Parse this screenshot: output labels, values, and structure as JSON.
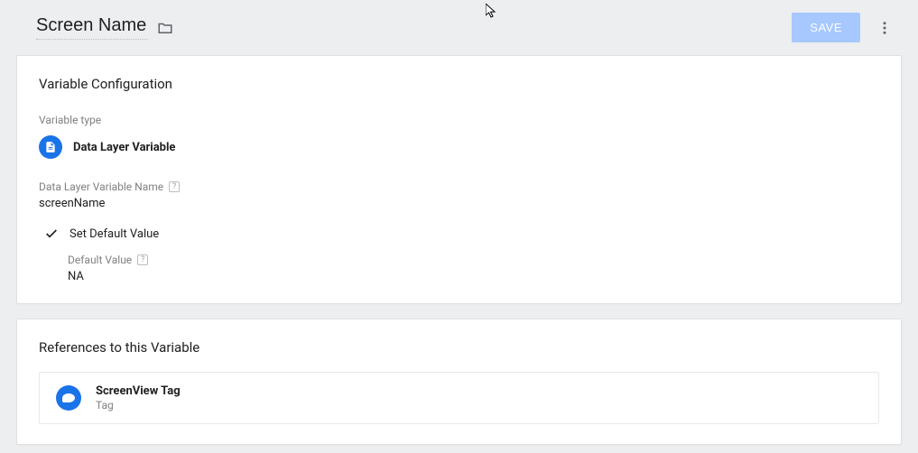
{
  "header": {
    "title": "Screen Name",
    "save_label": "SAVE"
  },
  "config": {
    "card_title": "Variable Configuration",
    "type_label": "Variable type",
    "type_value": "Data Layer Variable",
    "name_label": "Data Layer Variable Name",
    "name_value": "screenName",
    "set_default_label": "Set Default Value",
    "default_value_label": "Default Value",
    "default_value": "NA"
  },
  "references": {
    "card_title": "References to this Variable",
    "items": [
      {
        "name": "ScreenView Tag",
        "type": "Tag"
      }
    ]
  }
}
